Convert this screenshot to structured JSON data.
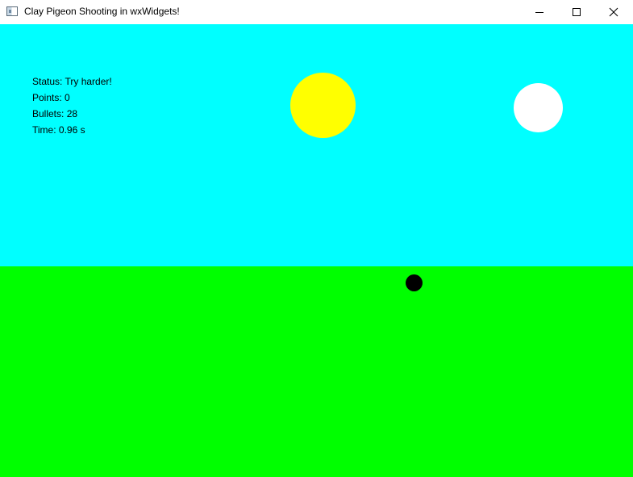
{
  "window": {
    "title": "Clay Pigeon Shooting in wxWidgets!",
    "icon": "app-window-icon",
    "controls": [
      "minimize-icon",
      "maximize-icon",
      "close-icon"
    ]
  },
  "hud": {
    "status_label": "Status:",
    "status_value": "Try harder!",
    "points_label": "Points:",
    "points_value": "0",
    "bullets_label": "Bullets:",
    "bullets_value": "28",
    "time_label": "Time:",
    "time_value": "0.96 s"
  },
  "colors": {
    "sky": "#00ffff",
    "ground": "#00ff00",
    "sun": "#ffff00",
    "clay_pigeon": "#ffffff",
    "crosshair_dot": "#000000"
  }
}
